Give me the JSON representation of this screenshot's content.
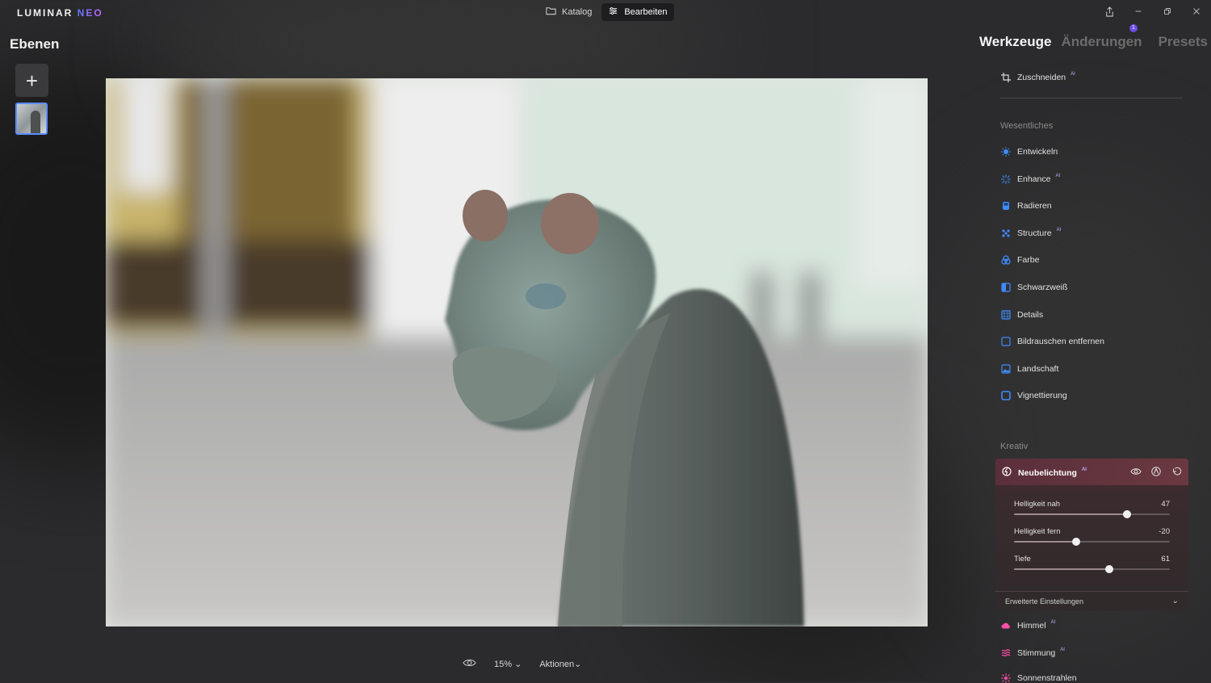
{
  "app": {
    "logo_main": "LUMINAR ",
    "logo_neo": "NEO"
  },
  "modes": [
    {
      "label": "Katalog",
      "icon": "folder-icon",
      "active": false
    },
    {
      "label": "Bearbeiten",
      "icon": "sliders-icon",
      "active": true
    }
  ],
  "window_controls": [
    "share-icon",
    "minimize-icon",
    "restore-icon",
    "close-icon"
  ],
  "layers": {
    "title": "Ebenen",
    "add_label": "+"
  },
  "bottom_bar": {
    "zoom": "15%",
    "actions": "Aktionen"
  },
  "right_tabs": [
    {
      "label": "Werkzeuge",
      "active": true
    },
    {
      "label": "Änderungen",
      "active": false,
      "badge": "1"
    },
    {
      "label": "Presets",
      "active": false
    }
  ],
  "tools": {
    "crop": {
      "label": "Zuschneiden",
      "ai": "AI"
    },
    "essentials_title": "Wesentliches",
    "essentials": [
      {
        "label": "Entwickeln",
        "icon": "sun-icon",
        "ai": ""
      },
      {
        "label": "Enhance",
        "icon": "sparkle-icon",
        "ai": "AI"
      },
      {
        "label": "Radieren",
        "icon": "eraser-icon",
        "ai": ""
      },
      {
        "label": "Structure",
        "icon": "structure-icon",
        "ai": "AI"
      },
      {
        "label": "Farbe",
        "icon": "color-icon",
        "ai": ""
      },
      {
        "label": "Schwarzweiß",
        "icon": "bw-icon",
        "ai": ""
      },
      {
        "label": "Details",
        "icon": "details-icon",
        "ai": ""
      },
      {
        "label": "Bildrauschen entfernen",
        "icon": "denoise-icon",
        "ai": ""
      },
      {
        "label": "Landschaft",
        "icon": "landscape-icon",
        "ai": ""
      },
      {
        "label": "Vignettierung",
        "icon": "vignette-icon",
        "ai": ""
      }
    ],
    "creative_title": "Kreativ",
    "relight": {
      "label": "Neubelichtung",
      "ai": "AI",
      "sliders": [
        {
          "label": "Helligkeit nah",
          "value": "47",
          "position": 0.725
        },
        {
          "label": "Helligkeit fern",
          "value": "-20",
          "position": 0.4
        },
        {
          "label": "Tiefe",
          "value": "61",
          "position": 0.61
        }
      ],
      "advanced": "Erweiterte Einstellungen"
    },
    "creative_more": [
      {
        "label": "Himmel",
        "icon": "cloud-icon",
        "ai": "AI"
      },
      {
        "label": "Stimmung",
        "icon": "mood-icon",
        "ai": "AI"
      },
      {
        "label": "Sonnenstrahlen",
        "icon": "sunrays-icon",
        "ai": ""
      }
    ]
  },
  "colors": {
    "accent_blue": "#3d8bff",
    "accent_pink": "#ff4fa8",
    "badge": "#6b4ce6"
  }
}
